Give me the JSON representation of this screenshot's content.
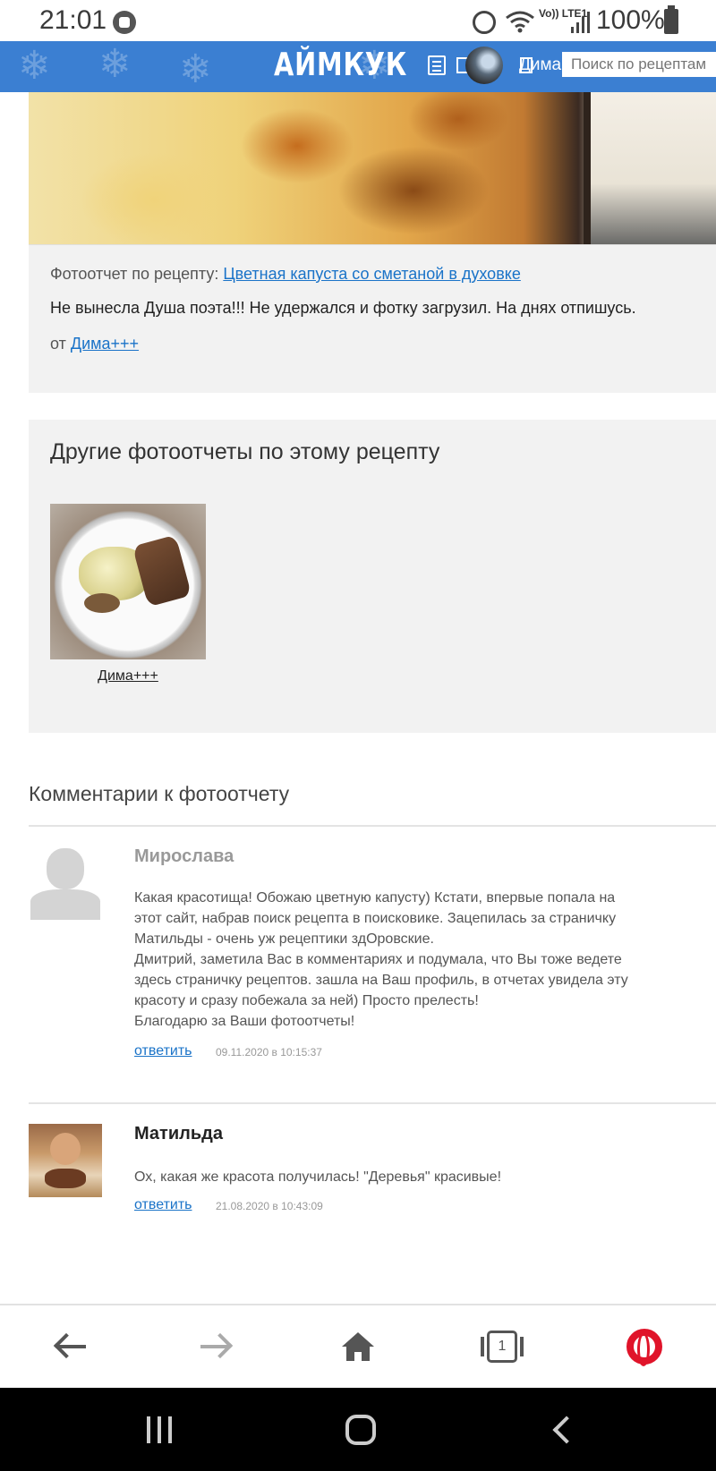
{
  "status_bar": {
    "time": "21:01",
    "network": "Vo)) LTE1",
    "battery": "100%"
  },
  "header": {
    "logo": "АЙМКУК",
    "user_name": "Дима",
    "search_placeholder": "Поиск по рецептам А"
  },
  "report": {
    "prefix": "Фотоотчет по рецепту: ",
    "recipe_link": "Цветная капуста со сметаной в духовке",
    "text": "Не вынесла Душа поэта!!! Не удержался и фотку загрузил. На днях отпишусь.",
    "author_prefix": "от ",
    "author": "Дима+++"
  },
  "others": {
    "title": "Другие фотоотчеты по этому рецепту",
    "items": [
      {
        "author": "Дима+++"
      }
    ]
  },
  "comments": {
    "title": "Комментарии к фотоотчету",
    "items": [
      {
        "name": "Мирослава",
        "name_color": "#999999",
        "lines": [
          "Какая красотища! Обожаю цветную капусту) Кстати, впервые попала на",
          "этот сайт, набрав поиск рецепта в поисковике. Зацепилась за страничку",
          "Матильды - очень уж рецептики здОровские.",
          "Дмитрий, заметила Вас в комментариях и подумала, что Вы тоже ведете",
          "здесь страничку рецептов. зашла на Ваш профиль, в отчетах увидела эту",
          "красоту и сразу побежала за ней) Просто прелесть!",
          "Благодарю за Ваши фотоотчеты!"
        ],
        "reply": "ответить",
        "date": "09.11.2020 в 10:15:37"
      },
      {
        "name": "Матильда",
        "name_color": "#222222",
        "lines": [
          "Ох, какая же красота получилась! \"Деревья\" красивые!"
        ],
        "reply": "ответить",
        "date": "21.08.2020 в 10:43:09"
      }
    ]
  },
  "browser_bar": {
    "tab_count": "1"
  },
  "colors": {
    "header": "#3b7fd2",
    "link": "#1a73c8",
    "panel": "#f2f2f2",
    "opera_red": "#e0142a"
  }
}
